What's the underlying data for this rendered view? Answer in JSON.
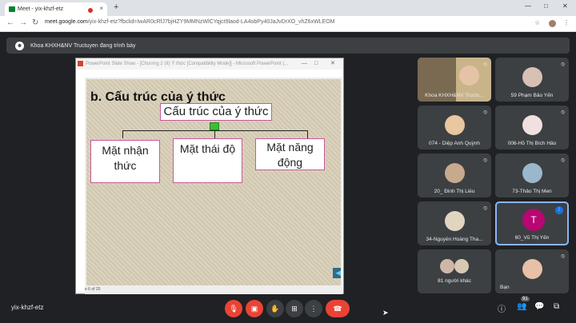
{
  "browser": {
    "tab_title": "Meet - yix-khzf-etz",
    "tab_close": "×",
    "new_tab": "+",
    "window_buttons": [
      "—",
      "□",
      "✕"
    ],
    "nav": [
      "←",
      "→",
      "↻"
    ],
    "url_host": "meet.google.com",
    "url_path": "/yix-khzf-etz?fbclid=IwAR0cRfJ7bjHZY9MMNzWlCYqjct9laod-LA4obPy40JaJvDrXO_vhZ6xWLEOM",
    "toolbar_icons": [
      "☆",
      "⋮"
    ]
  },
  "banner": {
    "text": "Khoa KHXH&NV Tructuyen đang trình bày",
    "icon": "present-icon"
  },
  "ppt_window": {
    "title": "PowerPoint Slide Show - [Chương 2 (II) Ý thức [Compatibility Mode]] - Microsoft PowerPoint (...",
    "buttons": [
      "—",
      "□",
      "✕"
    ],
    "status": "e 6 of 20"
  },
  "slide": {
    "heading": "b. Cấu trúc của ý thức",
    "center_box": "Cấu trúc của ý thức",
    "boxes": [
      "Mặt nhận thức",
      "Mặt thái độ",
      "Mặt năng động"
    ]
  },
  "participants": [
    {
      "name": "Khoa KHXH&NV Tructu...",
      "muted": true
    },
    {
      "name": "59 Phạm Bảo Yến",
      "muted": true
    },
    {
      "name": "074 - Diệp Anh Quỳnh",
      "muted": true
    },
    {
      "name": "006-Hồ Thị Bích Hảo",
      "muted": true
    },
    {
      "name": "20_ Đinh Thị Liễu",
      "muted": true
    },
    {
      "name": "73-Thảo Thị Men",
      "muted": true
    },
    {
      "name": "34-Nguyễn Hoàng Tha...",
      "muted": true
    },
    {
      "name": "60_Vũ Thị Yến",
      "initial": "T",
      "speaking": true
    },
    {
      "name": "81 người khác"
    },
    {
      "name": "Bạn",
      "muted": true
    }
  ],
  "bottom_bar": {
    "meeting_code": "yix-khzf-etz",
    "people_count": "91",
    "controls": [
      "mic-off",
      "camera-off",
      "raise-hand",
      "present",
      "more",
      "hang-up"
    ]
  },
  "colors": {
    "accent_red": "#ea4335",
    "tile_bg": "#3c4043",
    "bar_bg": "#202124"
  }
}
